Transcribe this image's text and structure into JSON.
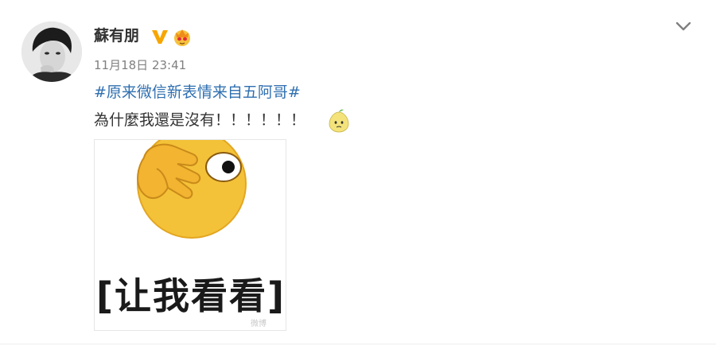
{
  "post": {
    "author": {
      "name": "蘇有朋",
      "avatar_icon": "avatar-portrait",
      "verified_icon": "verified-v-icon",
      "verified_color": "#f7a600",
      "member_icon": "crown-emoji-icon"
    },
    "timestamp": "11月18日 23:41",
    "hashtag": "#原来微信新表情来自五阿哥#",
    "text": "為什麼我還是沒有！！！！！！",
    "inline_emoji": "pear-face-emoji-icon",
    "image": {
      "caption": "[让我看看]",
      "watermark": "微博"
    },
    "menu_icon": "chevron-down-icon",
    "colors": {
      "hashtag": "#2f6fb0",
      "text": "#333333",
      "timestamp": "#808080"
    }
  }
}
